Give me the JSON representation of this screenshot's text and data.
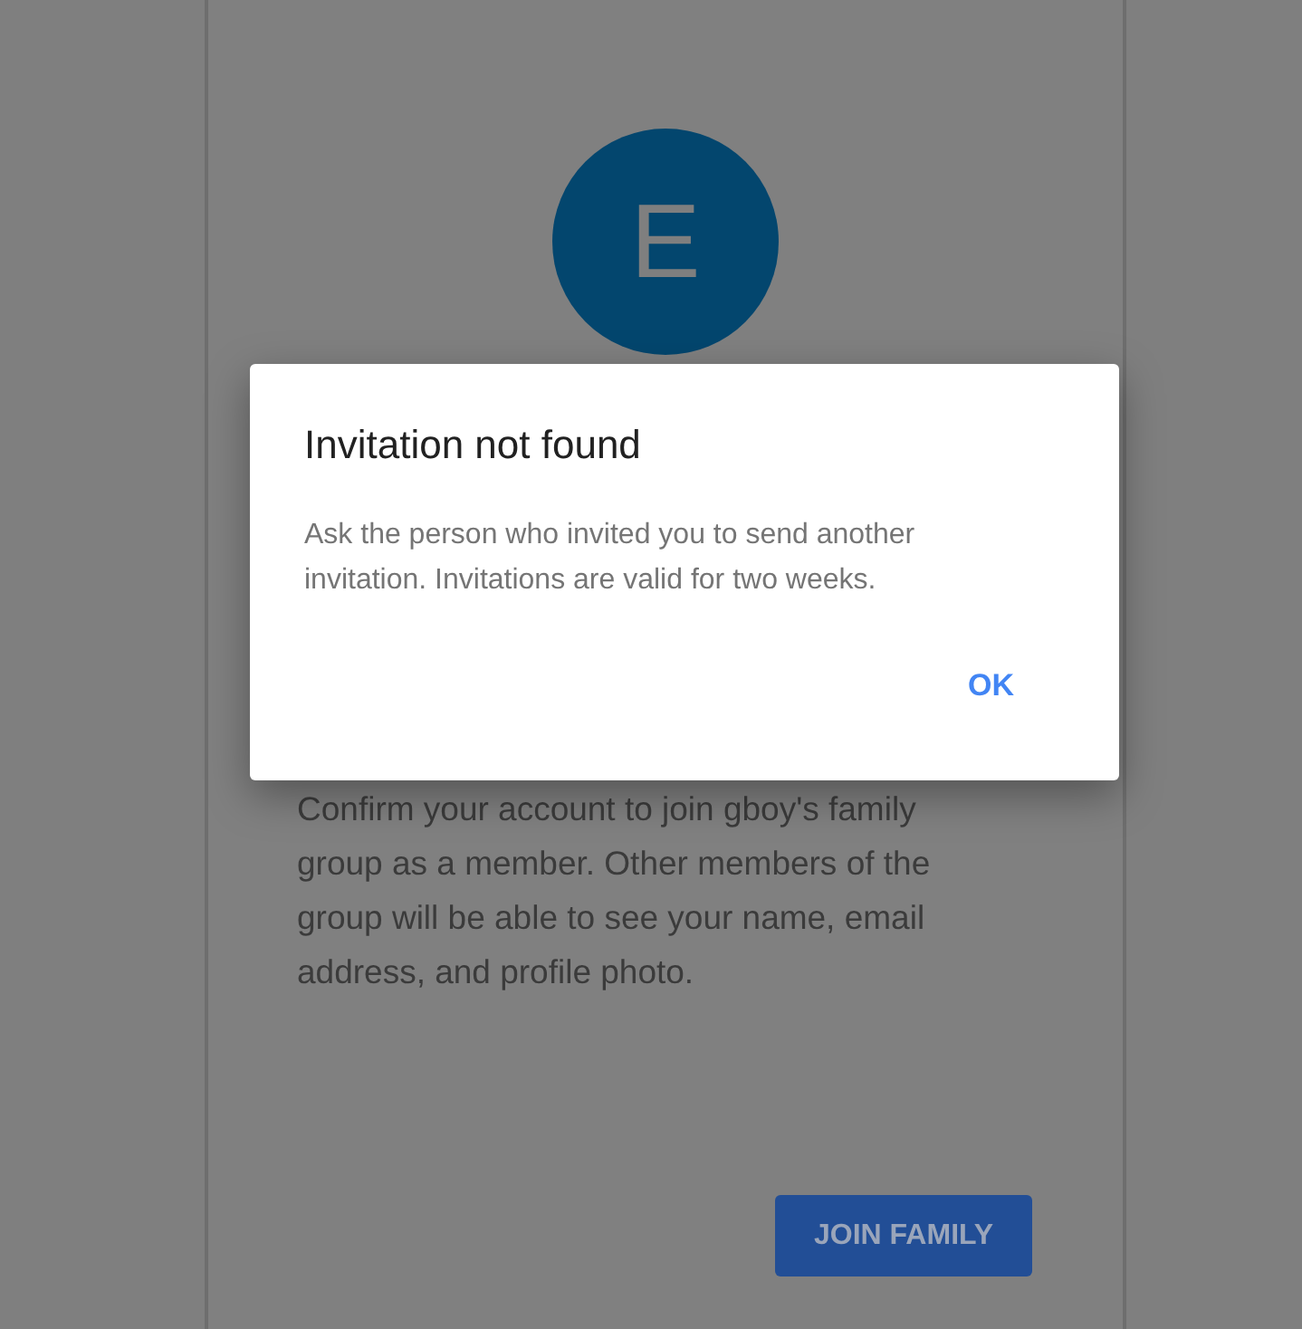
{
  "card": {
    "avatar_letter": "E",
    "description": "Confirm your account to join gboy's family group as a member. Other members of the group will be able to see your name, email address, and profile photo.",
    "button": "JOIN FAMILY"
  },
  "dialog": {
    "title": "Invitation not found",
    "message": "Ask the person who invited you to send another invitation. Invitations are valid for two weeks.",
    "buttons": [
      "OK"
    ]
  }
}
